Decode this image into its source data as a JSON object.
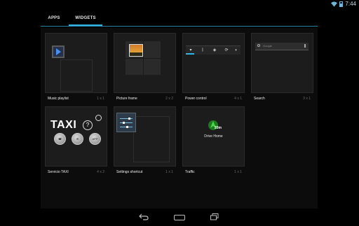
{
  "status_bar": {
    "time": "7:44",
    "icons": [
      "wifi-icon",
      "battery-icon"
    ]
  },
  "tabs": [
    {
      "label": "APPS",
      "active": false
    },
    {
      "label": "WIDGETS",
      "active": true
    }
  ],
  "widgets": [
    {
      "label": "Music playlist",
      "size": "1 x 1"
    },
    {
      "label": "Picture frame",
      "size": "2 x 2"
    },
    {
      "label": "Power control",
      "size": "4 x 1"
    },
    {
      "label": "Search",
      "size": "3 x 1"
    },
    {
      "label": "Servicio TAXI",
      "size": "4 x 2"
    },
    {
      "label": "Settings shortcut",
      "size": "1 x 1"
    },
    {
      "label": "Traffic",
      "size": "1 x 1"
    }
  ],
  "previews": {
    "search_text": "Google",
    "taxi_word": "TAXI",
    "taxi_help": "?",
    "taxi_app": "APP",
    "traffic_time": "20m",
    "traffic_label": "Drive Home"
  },
  "colors": {
    "accent": "#33b5e5",
    "background": "#000000",
    "tile": "#1c1c1c"
  },
  "nav_bar": [
    "back-icon",
    "home-icon",
    "recent-apps-icon"
  ]
}
